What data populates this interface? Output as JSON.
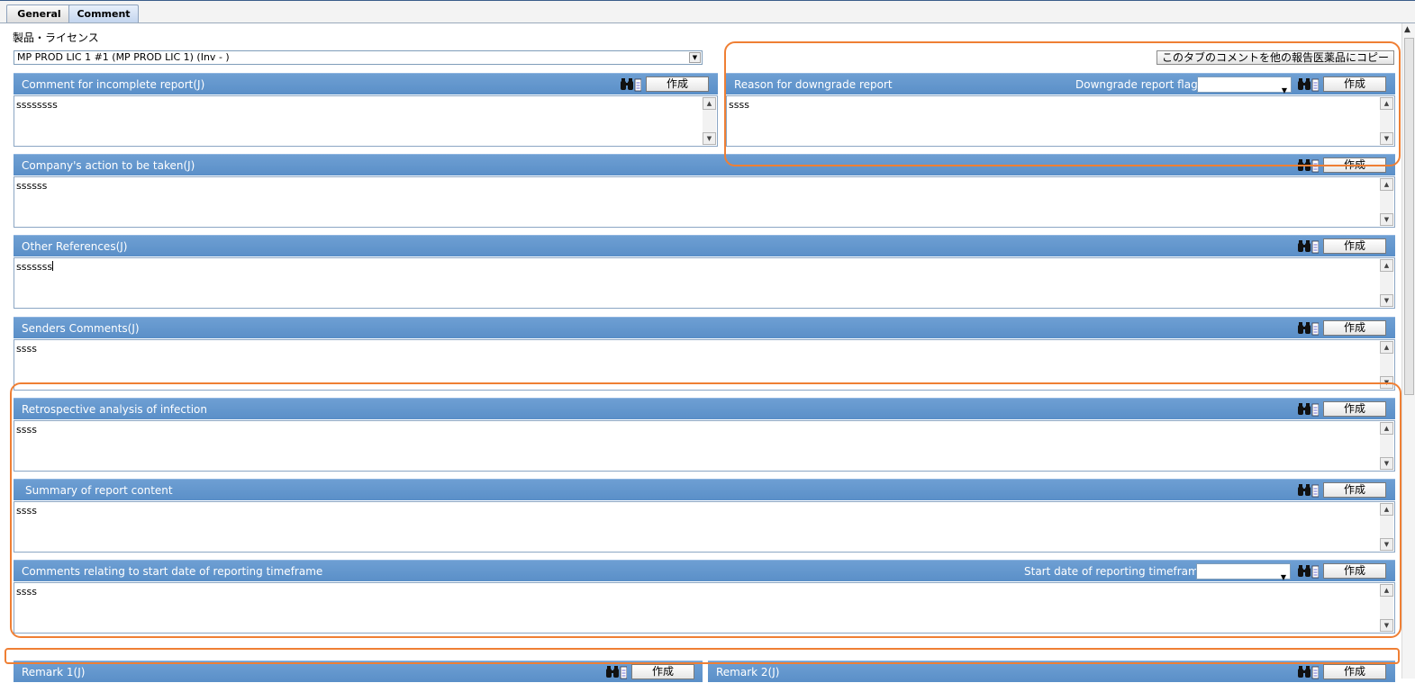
{
  "tabs": [
    {
      "label": "General"
    },
    {
      "label": "Comment"
    }
  ],
  "license": {
    "label": "製品・ライセンス",
    "selected": "MP PROD LIC 1 #1 (MP PROD LIC 1) (Inv - )"
  },
  "copy_button_label": "このタブのコメントを他の報告医薬品にコピー",
  "make_label": "作成",
  "sections": {
    "incomplete": {
      "title": "Comment for incomplete report(J)",
      "value": "ssssssss"
    },
    "downgrade": {
      "title": "Reason for downgrade report",
      "flag_label": "Downgrade report flag",
      "flag_value": "",
      "value": "ssss"
    },
    "company_action": {
      "title": "Company's action to be taken(J)",
      "value": "ssssss"
    },
    "other_refs": {
      "title": "Other References(J)",
      "value": "sssssss"
    },
    "senders": {
      "title": "Senders Comments(J)",
      "value": "ssss"
    },
    "retrospective": {
      "title": "Retrospective analysis of infection",
      "value": "ssss"
    },
    "summary": {
      "title": "Summary of report content",
      "value": "ssss"
    },
    "start_date_comments": {
      "title": "Comments relating to start date of reporting timeframe",
      "date_label": "Start date of reporting timeframe",
      "date_value": "",
      "value": "ssss"
    },
    "remark1": {
      "title": "Remark 1(J)"
    },
    "remark2": {
      "title": "Remark 2(J)"
    }
  },
  "colors": {
    "header_blue": "#5a8fc8",
    "highlight_orange": "#ef7f34"
  },
  "icons": {
    "binoculars": "binoculars-icon",
    "document": "document-icon"
  }
}
